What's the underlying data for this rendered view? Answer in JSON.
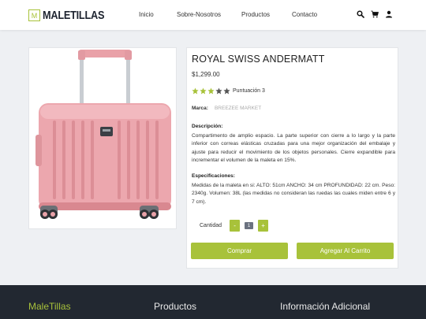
{
  "header": {
    "logo_mark": "M",
    "logo_text": "MALETILLAS",
    "nav": [
      "Inicio",
      "Sobre-Nosotros",
      "Productos",
      "Contacto"
    ],
    "icons": [
      "search-icon",
      "cart-icon",
      "user-icon"
    ]
  },
  "product": {
    "title": "ROYAL SWISS ANDERMATT",
    "price": "$1,299.00",
    "rating": 3,
    "rating_max": 5,
    "rating_label": "Puntuación 3",
    "brand_label": "Marca:",
    "brand_value": "BREEZEE MARKET",
    "description_heading": "Descripción:",
    "description": "Compartimento de amplio espacio. La parte superior con cierre a lo largo y la parte inferior con correas elásticas cruzadas para una mejor organización del embalaje y ajuste para reducir el movimiento de los objetos personales. Cierre expandible para incrementar el volumen de la maleta en 15%.",
    "specs_heading": "Especificaciones:",
    "specs": "Medidas de la maleta en si: ALTO: 51cm ANCHO: 34 cm PROFUNDIDAD: 22 cm. Peso: 2340g. Volumen: 38L (las medidas no consideran las ruedas las cuales miden entre 6 y 7 cm).",
    "quantity_label": "Cantidad",
    "quantity_minus": "-",
    "quantity_value": "1",
    "quantity_plus": "+",
    "buy_label": "Comprar",
    "add_to_cart_label": "Agregar Al Carrito"
  },
  "footer": {
    "col1": "MaleTillas",
    "col2": "Productos",
    "col3": "Información Adicional"
  },
  "colors": {
    "accent": "#a8c23a",
    "footer_bg": "#222831",
    "star_on": "#a8c23a",
    "star_off": "#555555",
    "suitcase": "#e9a1a8"
  }
}
